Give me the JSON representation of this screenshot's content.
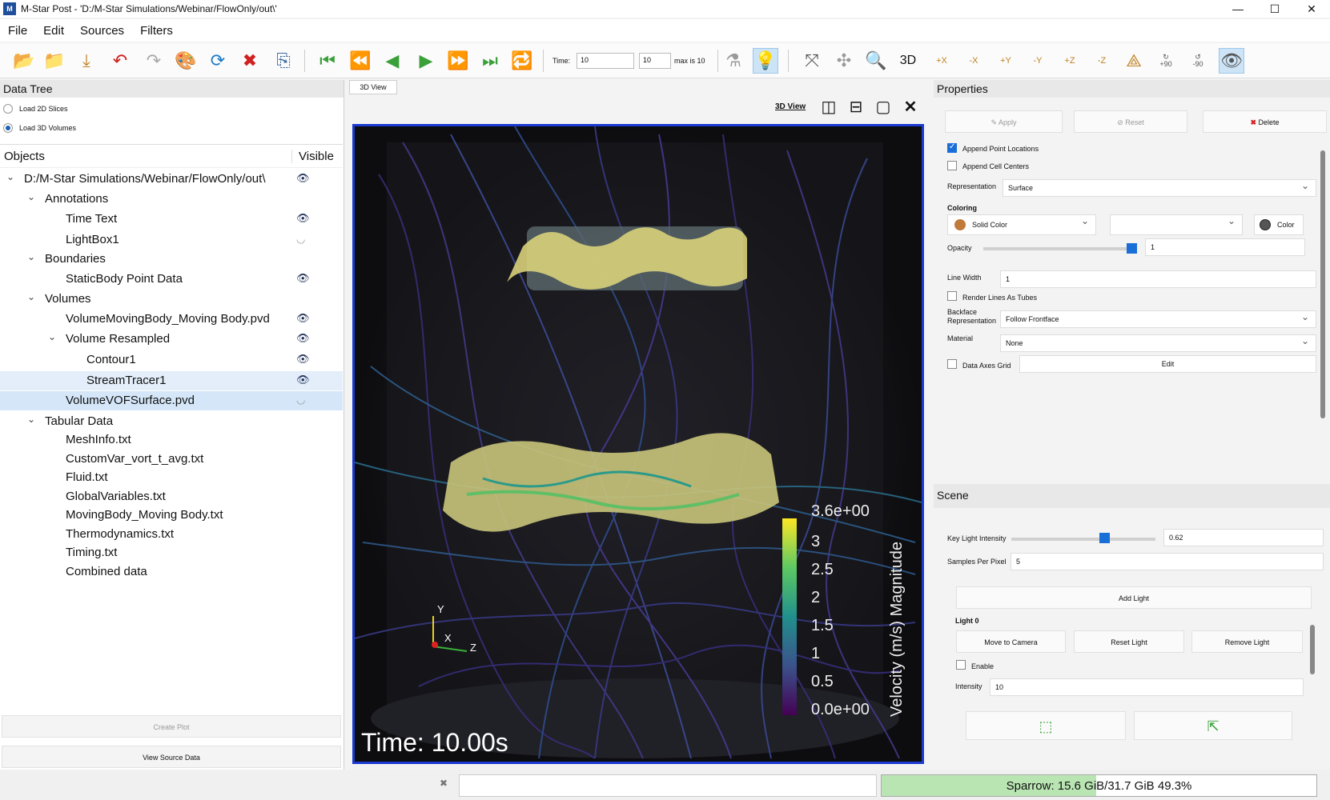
{
  "window": {
    "title": "M-Star Post - 'D:/M-Star Simulations/Webinar/FlowOnly/out\\'",
    "app_icon": "M"
  },
  "menu": [
    "File",
    "Edit",
    "Sources",
    "Filters"
  ],
  "toolbar": {
    "time_label": "Time:",
    "time_value": "10",
    "step_value": "10",
    "max_label": "max is 10",
    "view_3d": "3D",
    "rot_plus": "+90",
    "rot_minus": "-90",
    "axes": [
      "+X",
      "-X",
      "+Y",
      "-Y",
      "+Z",
      "-Z"
    ]
  },
  "datatree": {
    "header": "Data Tree",
    "load_2d": "Load 2D Slices",
    "load_3d": "Load 3D Volumes",
    "col_objects": "Objects",
    "col_visible": "Visible",
    "items": [
      {
        "label": "D:/M-Star Simulations/Webinar/FlowOnly/out\\",
        "visible": "shown"
      },
      {
        "label": "Annotations"
      },
      {
        "label": "Time Text",
        "visible": "shown"
      },
      {
        "label": "LightBox1",
        "visible": "hidden"
      },
      {
        "label": "Boundaries"
      },
      {
        "label": "StaticBody Point Data",
        "visible": "shown"
      },
      {
        "label": "Volumes"
      },
      {
        "label": "VolumeMovingBody_Moving Body.pvd",
        "visible": "shown"
      },
      {
        "label": "Volume Resampled",
        "visible": "shown"
      },
      {
        "label": "Contour1",
        "visible": "shown"
      },
      {
        "label": "StreamTracer1",
        "visible": "shown"
      },
      {
        "label": "VolumeVOFSurface.pvd",
        "visible": "hidden"
      },
      {
        "label": "Tabular Data"
      },
      {
        "label": "MeshInfo.txt"
      },
      {
        "label": "CustomVar_vort_t_avg.txt"
      },
      {
        "label": "Fluid.txt"
      },
      {
        "label": "GlobalVariables.txt"
      },
      {
        "label": "MovingBody_Moving Body.txt"
      },
      {
        "label": "Thermodynamics.txt"
      },
      {
        "label": "Timing.txt"
      },
      {
        "label": "Combined data"
      }
    ],
    "create_plot": "Create Plot",
    "view_source": "View Source Data"
  },
  "view": {
    "tab": "3D View",
    "title": "3D View",
    "time_text": "Time: 10.00s",
    "colorbar": {
      "title": "Velocity (m/s) Magnitude",
      "ticks": [
        "3.6e+00",
        "3",
        "2.5",
        "2",
        "1.5",
        "1",
        "0.5",
        "0.0e+00"
      ]
    },
    "axes": {
      "y": "Y",
      "x": "X",
      "z": "Z"
    }
  },
  "properties": {
    "header": "Properties",
    "apply": "Apply",
    "reset": "Reset",
    "delete": "Delete",
    "append_point": "Append Point Locations",
    "append_cell": "Append Cell Centers",
    "representation_label": "Representation",
    "representation": "Surface",
    "coloring_label": "Coloring",
    "coloring": "Solid Color",
    "color_btn": "Color",
    "opacity_label": "Opacity",
    "opacity": "1",
    "line_width_label": "Line Width",
    "line_width": "1",
    "render_tubes": "Render Lines As Tubes",
    "backface_label": "Backface Representation",
    "backface": "Follow Frontface",
    "material_label": "Material",
    "material": "None",
    "axes_grid": "Data Axes Grid",
    "edit": "Edit"
  },
  "scene": {
    "header": "Scene",
    "key_light_label": "Key Light Intensity",
    "key_light": "0.62",
    "spp_label": "Samples Per Pixel",
    "spp": "5",
    "add_light": "Add Light",
    "light0": "Light 0",
    "move_to_camera": "Move to Camera",
    "reset_light": "Reset Light",
    "remove_light": "Remove Light",
    "enable": "Enable",
    "intensity_label": "Intensity",
    "intensity": "10"
  },
  "status": {
    "memory": "Sparrow: 15.6 GiB/31.7 GiB 49.3%",
    "memory_fraction": 0.493
  },
  "colors": {
    "accent": "#1a6ed8",
    "viewport_border": "#1a3ad1",
    "memory_fill": "#b9e5b3"
  }
}
